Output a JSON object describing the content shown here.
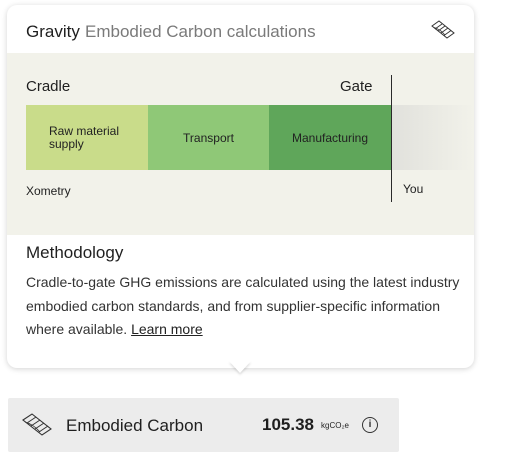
{
  "header": {
    "brand": "Gravity",
    "subtitle": "Embodied Carbon calculations",
    "logo_icon": "gravity-logo-icon"
  },
  "diagram": {
    "left_label": "Cradle",
    "right_label": "Gate",
    "stages": [
      {
        "label": "Raw material supply",
        "color": "#c9dc8a"
      },
      {
        "label": "Transport",
        "color": "#8fc877"
      },
      {
        "label": "Manufacturing",
        "color": "#5fa65a"
      }
    ],
    "bottom_left": "Xometry",
    "bottom_right": "You"
  },
  "methodology": {
    "title": "Methodology",
    "body": "Cradle-to-gate GHG emissions are calculated using the latest industry embodied carbon standards, and from supplier-specific information where available.",
    "link": "Learn more"
  },
  "summary": {
    "label": "Embodied Carbon",
    "value": "105.38",
    "unit": "kgCO₂e",
    "info_icon": "info-icon"
  }
}
